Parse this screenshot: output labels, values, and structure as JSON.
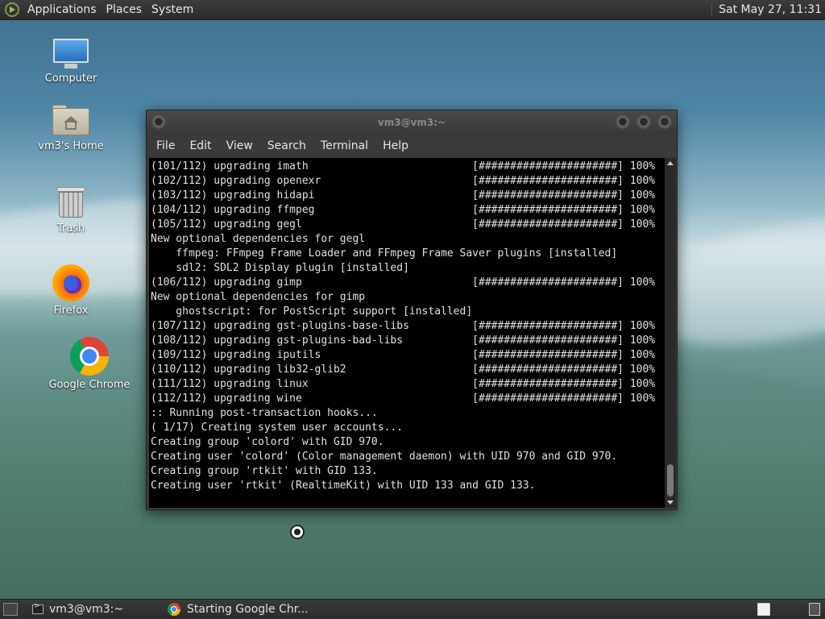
{
  "top_panel": {
    "menus": [
      "Applications",
      "Places",
      "System"
    ],
    "clock": "Sat May 27, 11:31"
  },
  "desktop_icons": [
    {
      "label": "Computer",
      "icon": "computer-icon"
    },
    {
      "label": "vm3's Home",
      "icon": "home-folder-icon"
    },
    {
      "label": "Trash",
      "icon": "trash-icon"
    },
    {
      "label": "Firefox",
      "icon": "firefox-icon"
    },
    {
      "label": "Google Chrome",
      "icon": "chrome-icon"
    }
  ],
  "terminal": {
    "title": "vm3@vm3:~",
    "menu": [
      "File",
      "Edit",
      "View",
      "Search",
      "Terminal",
      "Help"
    ],
    "lines": [
      "(101/112) upgrading imath                          [######################] 100%",
      "(102/112) upgrading openexr                        [######################] 100%",
      "(103/112) upgrading hidapi                         [######################] 100%",
      "(104/112) upgrading ffmpeg                         [######################] 100%",
      "(105/112) upgrading gegl                           [######################] 100%",
      "New optional dependencies for gegl",
      "    ffmpeg: FFmpeg Frame Loader and FFmpeg Frame Saver plugins [installed]",
      "    sdl2: SDL2 Display plugin [installed]",
      "(106/112) upgrading gimp                           [######################] 100%",
      "New optional dependencies for gimp",
      "    ghostscript: for PostScript support [installed]",
      "(107/112) upgrading gst-plugins-base-libs          [######################] 100%",
      "(108/112) upgrading gst-plugins-bad-libs           [######################] 100%",
      "(109/112) upgrading iputils                        [######################] 100%",
      "(110/112) upgrading lib32-glib2                    [######################] 100%",
      "(111/112) upgrading linux                          [######################] 100%",
      "(112/112) upgrading wine                           [######################] 100%",
      ":: Running post-transaction hooks...",
      "( 1/17) Creating system user accounts...",
      "Creating group 'colord' with GID 970.",
      "Creating user 'colord' (Color management daemon) with UID 970 and GID 970.",
      "Creating group 'rtkit' with GID 133.",
      "Creating user 'rtkit' (RealtimeKit) with UID 133 and GID 133."
    ]
  },
  "taskbar": {
    "tasks": [
      {
        "label": "vm3@vm3:~",
        "icon": "terminal-icon"
      },
      {
        "label": "Starting Google Chr...",
        "icon": "chrome-icon"
      }
    ]
  }
}
